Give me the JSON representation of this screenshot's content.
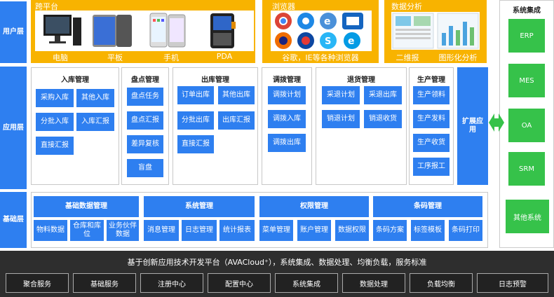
{
  "layers": {
    "user": "用户层",
    "app": "应用层",
    "base": "基础层"
  },
  "user_layer": {
    "cross_platform": {
      "title": "跨平台",
      "devices": [
        "电脑",
        "平板",
        "手机",
        "PDA"
      ]
    },
    "browser": {
      "title": "浏览器",
      "caption": "谷歌，IE等各种浏览器"
    },
    "analysis": {
      "title": "数据分析",
      "items": [
        "二维报",
        "图形化分析"
      ]
    }
  },
  "system_integration": {
    "title": "系统集成",
    "items": [
      "ERP",
      "MES",
      "OA",
      "SRM",
      "其他系统"
    ]
  },
  "app_layer": {
    "inbound": {
      "title": "入库管理",
      "items": [
        "采购入库",
        "其他入库",
        "分批入库",
        "入库汇报",
        "直接汇报"
      ]
    },
    "inventory": {
      "title": "盘点管理",
      "items": [
        "盘点任务",
        "盘点汇报",
        "差异复核",
        "盲盘"
      ]
    },
    "outbound": {
      "title": "出库管理",
      "items": [
        "订单出库",
        "其他出库",
        "分批出库",
        "出库汇报",
        "直接汇报"
      ]
    },
    "transfer": {
      "title": "调拨管理",
      "items": [
        "调拨计划",
        "调拨入库",
        "调拨出库"
      ]
    },
    "returns": {
      "title": "退货管理",
      "items": [
        "采退计划",
        "采退出库",
        "销退计划",
        "销退收货"
      ]
    },
    "production": {
      "title": "生产管理",
      "items": [
        "生产领料",
        "生产发料",
        "生产收货",
        "工序报工"
      ]
    },
    "extension": "扩展应用"
  },
  "base_layer": {
    "groups": [
      {
        "title": "基础数据管理",
        "items": [
          "物料数据",
          "仓库和库位",
          "业务伙伴数据"
        ]
      },
      {
        "title": "系统管理",
        "items": [
          "消息管理",
          "日志管理",
          "统计报表"
        ]
      },
      {
        "title": "权限管理",
        "items": [
          "菜单管理",
          "账户管理",
          "数据权限"
        ]
      },
      {
        "title": "条码管理",
        "items": [
          "条码方案",
          "标签模板",
          "条码打印"
        ]
      }
    ]
  },
  "platform": {
    "title": "基于创新应用技术开发平台（AVACloud⁺），系统集成、数据处理、均衡负载，服务标准",
    "services": [
      "聚合服务",
      "基础服务",
      "注册中心",
      "配置中心",
      "系统集成",
      "数据处理",
      "负载均衡",
      "日志预警"
    ]
  }
}
